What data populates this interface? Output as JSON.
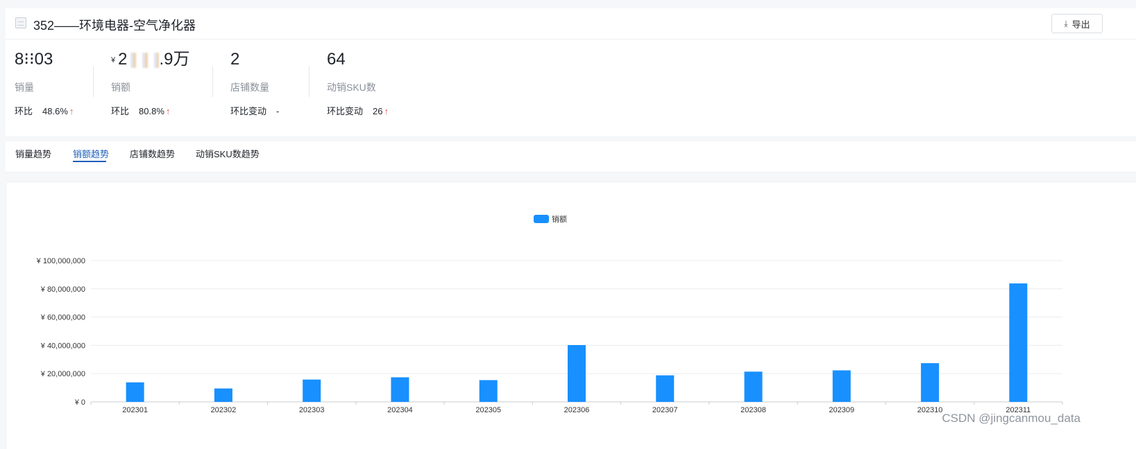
{
  "header": {
    "title": "352——环境电器-空气净化器",
    "export_label": "导出",
    "export_icon": "download-icon"
  },
  "metrics": [
    {
      "value": "8⁝⁝03",
      "label": "销量",
      "compare_key": "环比",
      "compare_value": "48.6%",
      "trend": "up"
    },
    {
      "currency": "¥",
      "value_prefix": "2",
      "value_suffix": ".9万",
      "label": "销额",
      "compare_key": "环比",
      "compare_value": "80.8%",
      "trend": "up"
    },
    {
      "value": "2",
      "label": "店铺数量",
      "compare_key": "环比变动",
      "compare_value": "-",
      "trend": "none"
    },
    {
      "value": "64",
      "label": "动销SKU数",
      "compare_key": "环比变动",
      "compare_value": "26",
      "trend": "up"
    }
  ],
  "tabs": [
    {
      "label": "销量趋势",
      "active": false
    },
    {
      "label": "销额趋势",
      "active": true
    },
    {
      "label": "店铺数趋势",
      "active": false
    },
    {
      "label": "动销SKU数趋势",
      "active": false
    }
  ],
  "colors": {
    "accent": "#1d5fb8",
    "bar": "#1890ff",
    "up": "#f04b4b"
  },
  "chart_data": {
    "type": "bar",
    "title": "",
    "xlabel": "",
    "ylabel": "",
    "categories": [
      "202301",
      "202302",
      "202303",
      "202304",
      "202305",
      "202306",
      "202307",
      "202308",
      "202309",
      "202310",
      "202311"
    ],
    "series": [
      {
        "name": "销额",
        "color": "#1890ff",
        "values": [
          13800000,
          9500000,
          15800000,
          17400000,
          15400000,
          40200000,
          18800000,
          21400000,
          22300000,
          27400000,
          83800000
        ]
      }
    ],
    "ylim": [
      0,
      100000000
    ],
    "yticks": [
      0,
      20000000,
      40000000,
      60000000,
      80000000,
      100000000
    ],
    "ytick_labels": [
      "¥ 0",
      "¥ 20,000,000",
      "¥ 40,000,000",
      "¥ 60,000,000",
      "¥ 80,000,000",
      "¥ 100,000,000"
    ],
    "legend": "top-center",
    "grid": true
  },
  "watermark": "CSDN @jingcanmou_data"
}
